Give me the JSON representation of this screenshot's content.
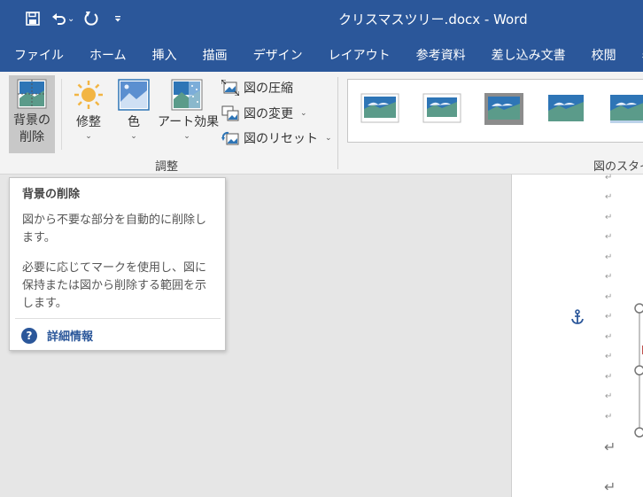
{
  "title": "クリスマスツリー.docx  -  Word",
  "tabs": [
    "ファイル",
    "ホーム",
    "挿入",
    "描画",
    "デザイン",
    "レイアウト",
    "参考資料",
    "差し込み文書",
    "校閲",
    "表示"
  ],
  "ribbon": {
    "remove_bg_line1": "背景の",
    "remove_bg_line2": "削除",
    "corrections": "修整",
    "color": "色",
    "artistic_effects": "アート効果",
    "compress": "図の圧縮",
    "change": "図の変更",
    "reset": "図のリセット",
    "adjust_group": "調整",
    "styles_group": "図のスタイル"
  },
  "tooltip": {
    "title": "背景の削除",
    "desc1": "図から不要な部分を自動的に削除します。",
    "desc2": "必要に応じてマークを使用し、図に保持または図から削除する範囲を示します。",
    "more": "詳細情報"
  },
  "doc": {
    "para_mark": "↵"
  },
  "colors": {
    "brand": "#2b579a",
    "ribbon_bg": "#f3f3f3",
    "active_btn": "#c8c8c8"
  },
  "icons": [
    "save-icon",
    "undo-icon",
    "redo-icon",
    "customize-qat-icon",
    "remove-background-icon",
    "corrections-icon",
    "color-icon",
    "artistic-effects-icon",
    "compress-icon",
    "change-picture-icon",
    "reset-picture-icon",
    "anchor-icon",
    "help-icon"
  ]
}
